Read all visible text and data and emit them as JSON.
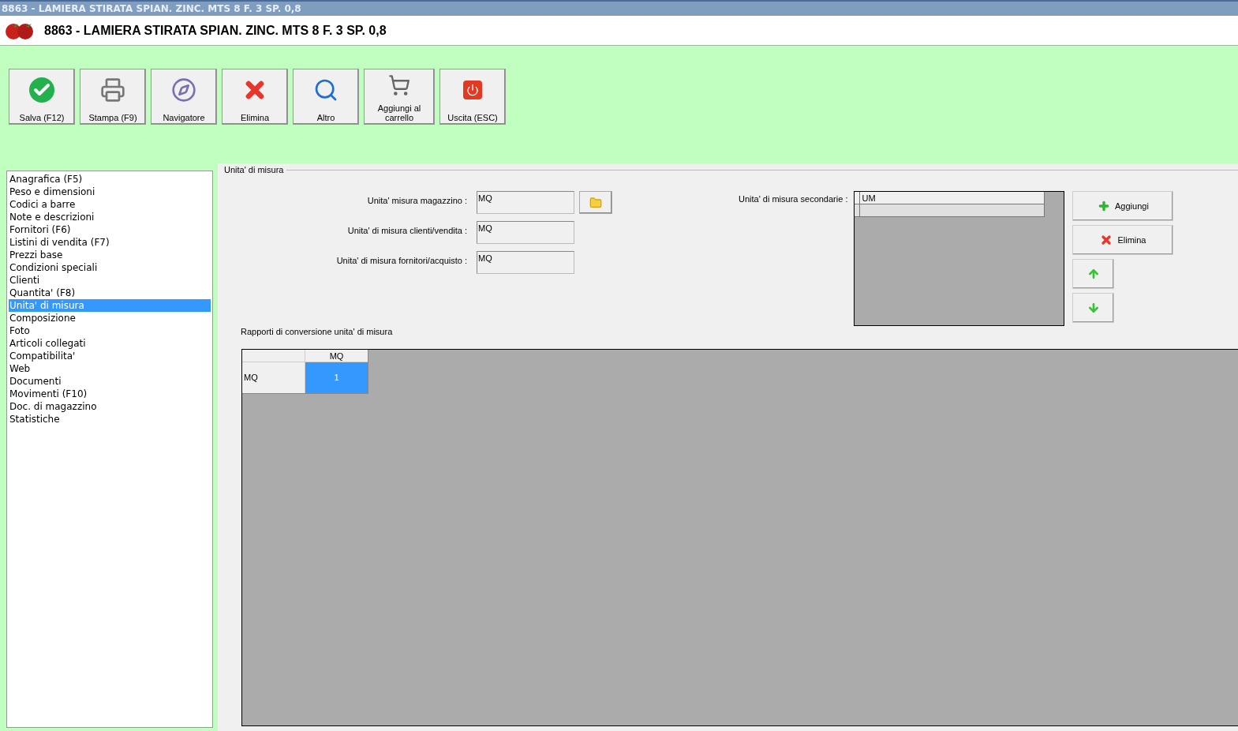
{
  "window": {
    "title": "8863 - LAMIERA STIRATA SPIAN. ZINC. MTS  8 F. 3 SP. 0,8"
  },
  "header": {
    "title": "8863 - LAMIERA STIRATA SPIAN. ZINC. MTS  8 F. 3 SP. 0,8"
  },
  "toolbar": [
    {
      "kind": "check",
      "label": "Salva (F12)"
    },
    {
      "kind": "printer",
      "label": "Stampa (F9)"
    },
    {
      "kind": "compass",
      "label": "Navigatore"
    },
    {
      "kind": "cross",
      "label": "Elimina"
    },
    {
      "kind": "search",
      "label": "Altro"
    },
    {
      "kind": "cart",
      "label": "Aggiungi al carrello"
    },
    {
      "kind": "power",
      "label": "Uscita (ESC)"
    }
  ],
  "sidebar": {
    "items": [
      {
        "label": "Anagrafica (F5)",
        "selected": false
      },
      {
        "label": "Peso e dimensioni",
        "selected": false
      },
      {
        "label": "Codici a barre",
        "selected": false
      },
      {
        "label": "Note e descrizioni",
        "selected": false
      },
      {
        "label": "Fornitori (F6)",
        "selected": false
      },
      {
        "label": "Listini di vendita (F7)",
        "selected": false
      },
      {
        "label": "Prezzi base",
        "selected": false
      },
      {
        "label": "Condizioni speciali",
        "selected": false
      },
      {
        "label": "Clienti",
        "selected": false
      },
      {
        "label": "Quantita' (F8)",
        "selected": false
      },
      {
        "label": "Unita' di misura",
        "selected": true
      },
      {
        "label": "Composizione",
        "selected": false
      },
      {
        "label": "Foto",
        "selected": false
      },
      {
        "label": "Articoli collegati",
        "selected": false
      },
      {
        "label": "Compatibilita'",
        "selected": false
      },
      {
        "label": "Web",
        "selected": false
      },
      {
        "label": "Documenti",
        "selected": false
      },
      {
        "label": "Movimenti (F10)",
        "selected": false
      },
      {
        "label": "Doc. di magazzino",
        "selected": false
      },
      {
        "label": "Statistiche",
        "selected": false
      }
    ]
  },
  "panel": {
    "title": "Unita' di misura",
    "fields": [
      {
        "label": "Unita' misura magazzino :",
        "value": "MQ",
        "browse": true
      },
      {
        "label": "Unita' di misura clienti/vendita :",
        "value": "MQ",
        "browse": false
      },
      {
        "label": "Unita' di misura fornitori/acquisto :",
        "value": "MQ",
        "browse": false
      }
    ],
    "secondary": {
      "label": "Unita' di misura secondarie :",
      "column": "UM"
    },
    "buttons": [
      {
        "kind": "add",
        "label": "Aggiungi"
      },
      {
        "kind": "delete",
        "label": "Elimina"
      },
      {
        "kind": "up"
      },
      {
        "kind": "down"
      }
    ],
    "conversion": {
      "title": "Rapporti di conversione unita' di misura",
      "columns": [
        "MQ"
      ],
      "rows": [
        {
          "label": "MQ",
          "cells": [
            {
              "value": "1",
              "selected": true
            }
          ]
        }
      ]
    }
  }
}
